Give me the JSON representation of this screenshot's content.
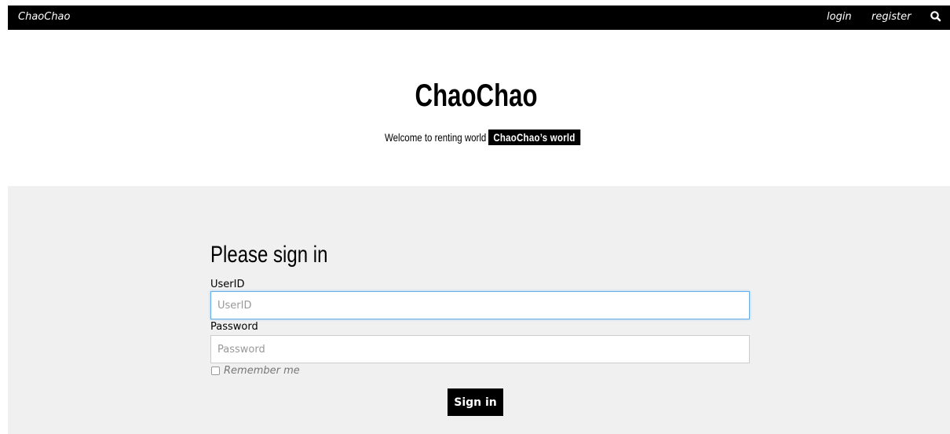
{
  "navbar": {
    "brand": "ChaoChao",
    "login_label": "login",
    "register_label": "register",
    "search_icon": "search-icon"
  },
  "header": {
    "title": "ChaoChao",
    "tagline": "Welcome to renting world",
    "tagline_badge": "ChaoChao’s world"
  },
  "signin": {
    "heading": "Please sign in",
    "userid_label": "UserID",
    "userid_placeholder": "UserID",
    "userid_value": "",
    "password_label": "Password",
    "password_placeholder": "Password",
    "password_value": "",
    "remember_label": "Remember me",
    "remember_checked": false,
    "submit_label": "Sign in"
  },
  "colors": {
    "navbar_bg": "#000000",
    "section_bg": "#f0f0f0",
    "focus_border": "#66afe9",
    "button_bg": "#000000"
  }
}
